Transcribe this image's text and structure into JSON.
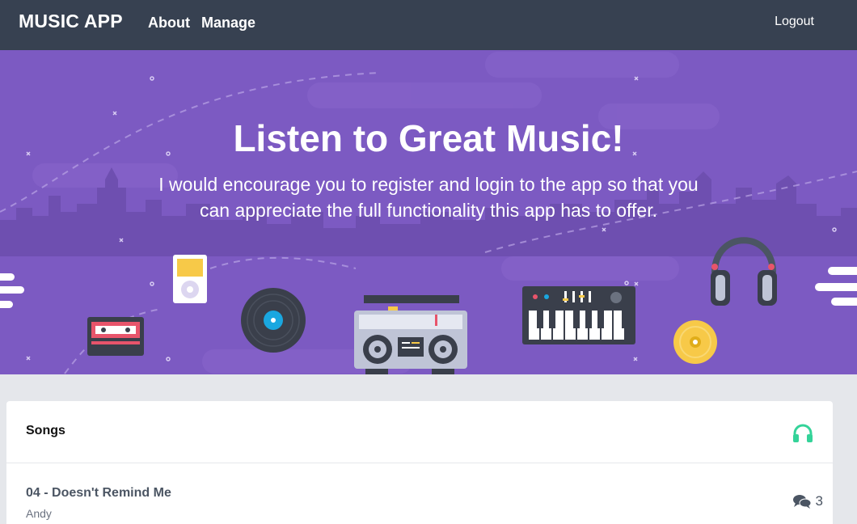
{
  "navbar": {
    "brand": "MUSIC APP",
    "links": [
      {
        "label": "About"
      },
      {
        "label": "Manage"
      }
    ],
    "logout_label": "Logout"
  },
  "hero": {
    "title": "Listen to Great Music!",
    "subtitle": "I would encourage you to register and login to the app so that you can appreciate the full functionality this app has to offer.",
    "background_color": "#7c5ac2"
  },
  "songs": {
    "title": "Songs",
    "header_icon": "headphones-icon",
    "accent_color": "#34d399",
    "items": [
      {
        "title": "04 - Doesn't Remind Me",
        "artist": "Andy",
        "comments": "3"
      }
    ]
  }
}
